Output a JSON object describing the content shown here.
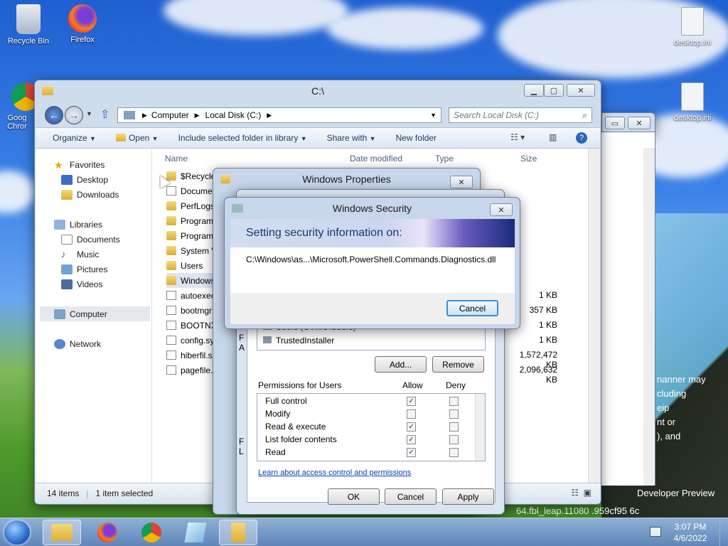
{
  "desktop": {
    "icons": [
      {
        "label": "Recycle Bin",
        "icon": "recycle-bin-icon"
      },
      {
        "label": "Firefox",
        "icon": "firefox-icon"
      },
      {
        "label": "Goog Chror",
        "icon": "chrome-icon"
      },
      {
        "label": "desktop.ini",
        "icon": "settings-file-icon"
      },
      {
        "label": "desktop.ini",
        "icon": "settings-file-icon"
      }
    ],
    "bg_text": [
      "nanner may",
      "cluding",
      "eip",
      "nt or",
      "), and",
      "Developer Preview",
      "64.fbl_leap.11080",
      ".959cf95",
      "6c"
    ]
  },
  "explorer": {
    "title": "C:\\",
    "breadcrumb": [
      "Computer",
      "Local Disk (C:)"
    ],
    "search_placeholder": "Search Local Disk (C:)",
    "toolbar": {
      "organize": "Organize",
      "open": "Open",
      "include": "Include selected folder in library",
      "share": "Share with",
      "new_folder": "New folder"
    },
    "nav": {
      "favorites": "Favorites",
      "desktop": "Desktop",
      "downloads": "Downloads",
      "libraries": "Libraries",
      "documents": "Documents",
      "music": "Music",
      "pictures": "Pictures",
      "videos": "Videos",
      "computer": "Computer",
      "network": "Network"
    },
    "columns": {
      "name": "Name",
      "date": "Date modified",
      "type": "Type",
      "size": "Size"
    },
    "files": [
      {
        "name": "$Recycle",
        "kind": "folder",
        "size": ""
      },
      {
        "name": "Docume",
        "kind": "shortcut",
        "size": ""
      },
      {
        "name": "PerfLogs",
        "kind": "folder",
        "size": ""
      },
      {
        "name": "Program",
        "kind": "folder",
        "size": ""
      },
      {
        "name": "Program",
        "kind": "folder",
        "size": ""
      },
      {
        "name": "System V",
        "kind": "folder",
        "size": ""
      },
      {
        "name": "Users",
        "kind": "folder",
        "size": ""
      },
      {
        "name": "Windows",
        "kind": "folder",
        "size": ""
      },
      {
        "name": "autoexec",
        "kind": "file",
        "size": "1 KB"
      },
      {
        "name": "bootmgr",
        "kind": "file",
        "size": "357 KB"
      },
      {
        "name": "BOOTNX",
        "kind": "file",
        "size": "1 KB"
      },
      {
        "name": "config.sy",
        "kind": "file",
        "size": "1 KB"
      },
      {
        "name": "hiberfil.s",
        "kind": "file",
        "size": "1,572,472 KB"
      },
      {
        "name": "pagefile.",
        "kind": "file",
        "size": "2,096,632 KB"
      }
    ],
    "status": {
      "count": "14 items",
      "selected": "1 item selected"
    }
  },
  "properties": {
    "title": "Windows Properties",
    "users": [
      "Users (CVMU\\Users)",
      "TrustedInstaller"
    ],
    "add": "Add...",
    "remove": "Remove",
    "perm_header": "Permissions for Users",
    "allow": "Allow",
    "deny": "Deny",
    "perms": [
      {
        "name": "Full control",
        "allow": true,
        "deny": false
      },
      {
        "name": "Modify",
        "allow": false,
        "deny": false
      },
      {
        "name": "Read & execute",
        "allow": true,
        "deny": false
      },
      {
        "name": "List folder contents",
        "allow": true,
        "deny": false
      },
      {
        "name": "Read",
        "allow": true,
        "deny": false
      }
    ],
    "link": "Learn about access control and permissions",
    "ok": "OK",
    "cancel": "Cancel",
    "apply": "Apply",
    "partial": [
      "F",
      "A",
      "F",
      "L"
    ]
  },
  "security": {
    "title": "Windows Security",
    "heading": "Setting security information on:",
    "path": "C:\\Windows\\as...\\Microsoft.PowerShell.Commands.Diagnostics.dll",
    "cancel": "Cancel"
  },
  "taskbar": {
    "time": "3:07 PM",
    "date": "4/6/2022"
  }
}
